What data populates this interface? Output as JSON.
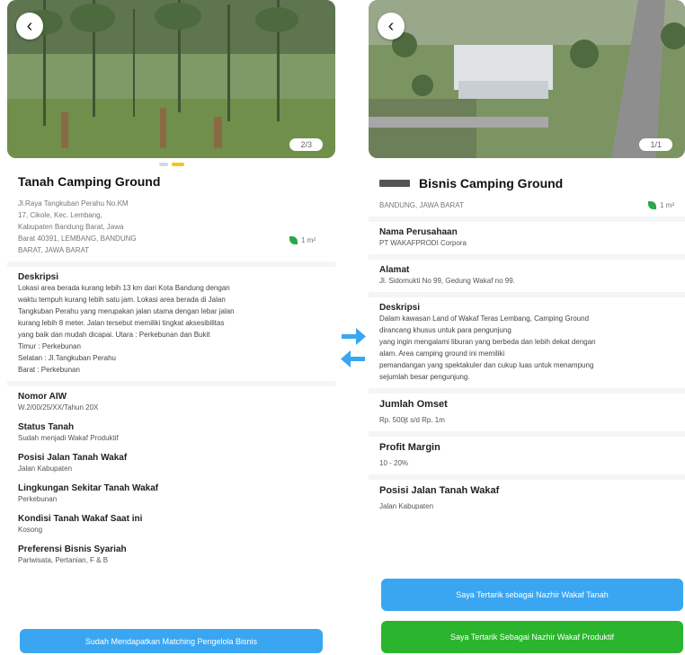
{
  "left": {
    "photo_counter": "2/3",
    "title": "Tanah Camping Ground",
    "address_lines": [
      "Jl.Raya Tangkuban Perahu No.KM",
      "17, Cikole, Kec. Lembang,",
      "Kabupaten Bandung Barat, Jawa",
      "Barat 40391, LEMBANG, BANDUNG",
      "BARAT, JAWA BARAT"
    ],
    "area": "1 m²",
    "deskripsi_label": "Deskripsi",
    "deskripsi_lines": [
      "Lokasi area berada kurang lebih 13 km dari Kota Bandung dengan",
      "waktu tempuh kurang lebih satu jam. Lokasi area berada di Jalan",
      "Tangkuban Perahu yang merupakan jalan utama dengan lebar jalan",
      "kurang lebih 8 meter. Jalan tersebut memiliki tingkat aksesibilitas",
      "yang baik dan mudah dicapai.  Utara :      Perkebunan dan Bukit",
      "Timur :      Perkebunan",
      "Selatan :   Jl.Tangkuban Perahu",
      "Barat :      Perkebunan"
    ],
    "fields": [
      {
        "label": "Nomor AIW",
        "value": "W.2/00/25/XX/Tahun 20X"
      },
      {
        "label": "Status Tanah",
        "value": "Sudah menjadi Wakaf Produktif"
      },
      {
        "label": "Posisi Jalan Tanah Wakaf",
        "value": "Jalan Kabupaten"
      },
      {
        "label": "Lingkungan Sekitar Tanah Wakaf",
        "value": "Perkebunan"
      },
      {
        "label": "Kondisi Tanah Wakaf Saat ini",
        "value": "Kosong"
      },
      {
        "label": "Preferensi Bisnis Syariah",
        "value": "Pariwisata, Pertanian, F & B"
      }
    ],
    "button": "Sudah Mendapatkan Matching Pengelola Bisnis"
  },
  "right": {
    "photo_counter": "1/1",
    "title": "Bisnis Camping Ground",
    "location": "BANDUNG, JAWA BARAT",
    "area": "1 m²",
    "perusahaan_label": "Nama Perusahaan",
    "perusahaan_value": "PT WAKAFPRODI Corpora",
    "alamat_label": "Alamat",
    "alamat_value": "Jl. Sidomukti No 99, Gedung Wakaf no 99.",
    "deskripsi_label": "Deskripsi",
    "deskripsi_lines": [
      "Dalam kawasan Land of Wakaf Teras Lembang, Camping Ground",
      "dirancang khusus untuk para pengunjung",
      "yang ingin mengalami liburan yang berbeda dan lebih dekat dengan",
      "alam. Area camping ground ini memiliki",
      "pemandangan yang spektakuler dan cukup luas untuk menampung",
      "sejumlah besar pengunjung."
    ],
    "omset_label": "Jumlah Omset",
    "omset_value": "Rp. 500jt s/d Rp. 1m",
    "profit_label": "Profit Margin",
    "profit_value": "10 - 20%",
    "posisi_label": "Posisi Jalan Tanah Wakaf",
    "posisi_value": "Jalan Kabupaten",
    "button_blue": "Saya Tertarik sebagai Nazhir Wakaf Tanah",
    "button_green": "Saya Tertarik Sebagai Nazhir Wakaf Produktif"
  },
  "colors": {
    "accent_blue": "#3aa6f2",
    "accent_green": "#2bb52e",
    "dot_active": "#f3c614"
  },
  "icons": [
    "back-arrow-icon",
    "leaf-area-icon",
    "arrow-right-icon",
    "arrow-left-icon",
    "company-logo-icon"
  ]
}
